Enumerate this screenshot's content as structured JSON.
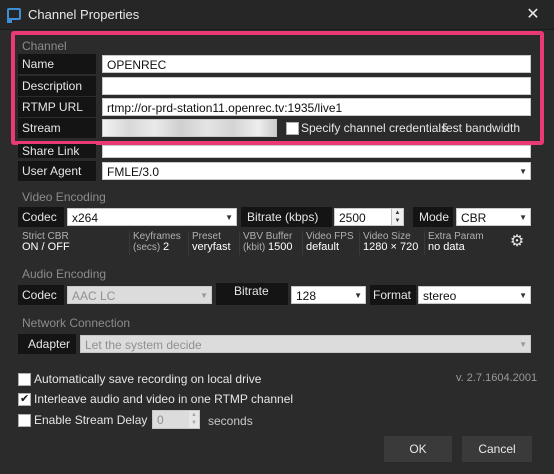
{
  "window": {
    "title": "Channel Properties",
    "close_symbol": "✕"
  },
  "channel": {
    "section_label": "Channel",
    "name_label": "Name",
    "name_value": "OPENREC",
    "description_label": "Description",
    "description_value": "",
    "rtmp_label": "RTMP URL",
    "rtmp_value": "rtmp://or-prd-station11.openrec.tv:1935/live1",
    "stream_name_label": "Stream Name",
    "specify_credentials_label": "Specify channel credentials",
    "test_bandwidth_label": "Test bandwidth",
    "share_link_label": "Share Link",
    "share_link_value": "",
    "user_agent_label": "User Agent",
    "user_agent_value": "FMLE/3.0"
  },
  "video": {
    "section_label": "Video Encoding",
    "codec_label": "Codec",
    "codec_value": "x264",
    "bitrate_label": "Bitrate (kbps)",
    "bitrate_value": "2500",
    "mode_label": "Mode",
    "mode_value": "CBR",
    "info": [
      {
        "label1": "Strict CBR",
        "label2": "",
        "value": "ON / OFF"
      },
      {
        "label1": "Keyframes",
        "label2": "(secs)",
        "value": "2"
      },
      {
        "label1": "Preset",
        "label2": "",
        "value": "veryfast"
      },
      {
        "label1": "VBV Buffer",
        "label2": "(kbit)",
        "value": "1500"
      },
      {
        "label1": "Video FPS",
        "label2": "",
        "value": "default"
      },
      {
        "label1": "Video Size",
        "label2": "",
        "value": "1280 × 720"
      },
      {
        "label1": "Extra Param",
        "label2": "",
        "value": "no data"
      }
    ]
  },
  "audio": {
    "section_label": "Audio Encoding",
    "codec_label": "Codec",
    "codec_value": "AAC LC",
    "bitrate_label": "Bitrate",
    "bitrate_value": "128",
    "format_label": "Format",
    "format_value": "stereo"
  },
  "network": {
    "section_label": "Network Connection",
    "adapter_label": "Adapter",
    "adapter_value": "Let the system decide"
  },
  "options": {
    "auto_save_label": "Automatically save recording on local drive",
    "auto_save_checked": false,
    "interleave_label": "Interleave audio and video in one RTMP channel",
    "interleave_checked": true,
    "delay_label": "Enable Stream Delay",
    "delay_checked": false,
    "delay_value": "0",
    "delay_unit": "seconds"
  },
  "version": "v. 2.7.1604.2001",
  "buttons": {
    "ok": "OK",
    "cancel": "Cancel"
  },
  "colors": {
    "highlight": "#ea3a73",
    "accent": "#3d8fd6",
    "background": "#2b2b2b"
  }
}
